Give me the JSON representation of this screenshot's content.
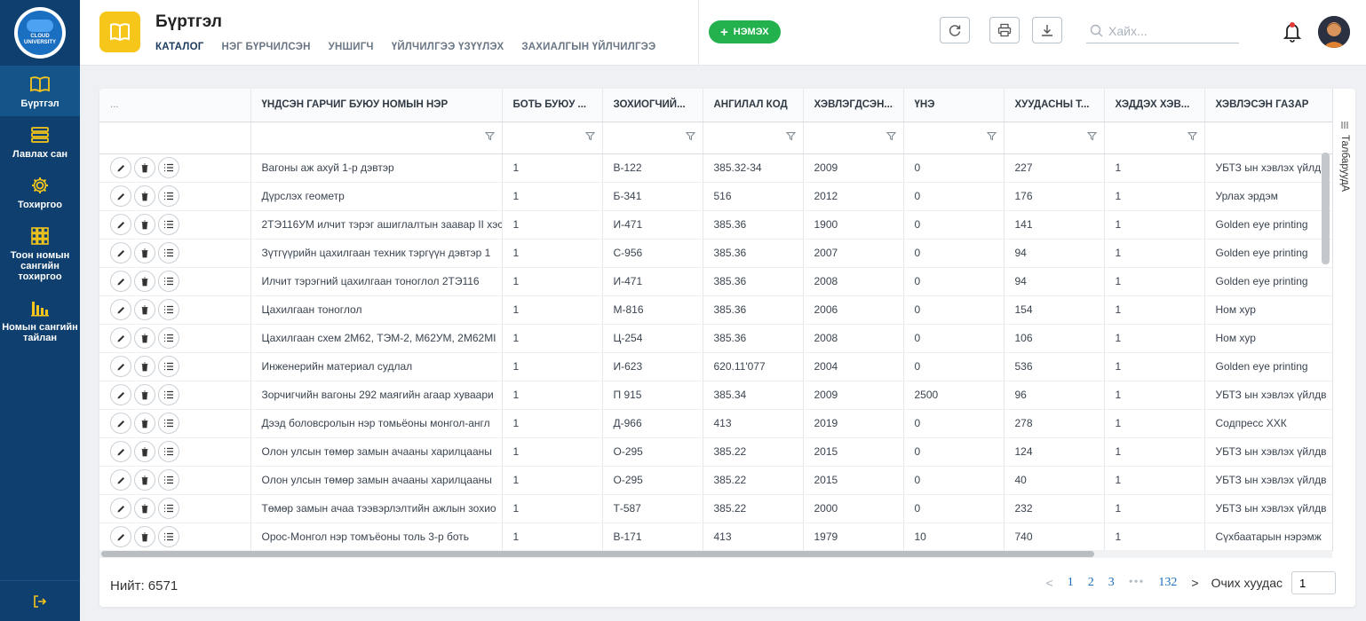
{
  "logo": {
    "line1": "CLOUD",
    "line2": "UNIVERSITY"
  },
  "sidebar": {
    "items": [
      {
        "label": "Бүртгэл",
        "icon": "book-icon"
      },
      {
        "label": "Лавлах сан",
        "icon": "layers-icon"
      },
      {
        "label": "Тохиргоо",
        "icon": "gear-icon"
      },
      {
        "label": "Тоон номын сангийн тохиргоо",
        "icon": "grid-icon"
      },
      {
        "label": "Номын сангийн тайлан",
        "icon": "report-icon"
      }
    ],
    "logout_icon": "logout-icon"
  },
  "header": {
    "title": "Бүртгэл",
    "tabs": [
      "КАТАЛОГ",
      "НЭГ БҮРЧИЛСЭН",
      "УНШИГЧ",
      "ҮЙЛЧИЛГЭЭ ҮЗҮҮЛЭХ",
      "ЗАХИАЛГЫН ҮЙЛЧИЛГЭЭ"
    ],
    "add_label": "НЭМЭХ",
    "search_placeholder": "Хайх..."
  },
  "table": {
    "columns": [
      "...",
      "ҮНДСЭН ГАРЧИГ БУЮУ НОМЫН НЭР",
      "БОТЬ БУЮУ ...",
      "ЗОХИОГЧИЙ...",
      "АНГИЛАЛ КОД",
      "ХЭВЛЭГДСЭН...",
      "ҮНЭ",
      "ХУУДАСНЫ Т...",
      "ХЭДДЭХ ХЭВ...",
      "ХЭВЛЭСЭН ГАЗАР"
    ],
    "rows": [
      [
        "Вагоны аж ахуй 1-р дэвтэр",
        "1",
        "В-122",
        "385.32-34",
        "2009",
        "0",
        "227",
        "1",
        "УБТЗ ын хэвлэх үйлдв"
      ],
      [
        "Дүрслэх геометр",
        "1",
        "Б-341",
        "516",
        "2012",
        "0",
        "176",
        "1",
        "Урлах эрдэм"
      ],
      [
        "2ТЭ116УМ илчит тэрэг ашиглалтын заавар II хэс",
        "1",
        "И-471",
        "385.36",
        "1900",
        "0",
        "141",
        "1",
        "Golden eye printing"
      ],
      [
        "Зүтгүүрийн цахилгаан техник тэргүүн дэвтэр 1",
        "1",
        "С-956",
        "385.36",
        "2007",
        "0",
        "94",
        "1",
        "Golden eye printing"
      ],
      [
        "Илчит тэрэгний цахилгаан тоноглол 2ТЭ116",
        "1",
        "И-471",
        "385.36",
        "2008",
        "0",
        "94",
        "1",
        "Golden eye printing"
      ],
      [
        "Цахилгаан тоноглол",
        "1",
        "М-816",
        "385.36",
        "2006",
        "0",
        "154",
        "1",
        "Ном хур"
      ],
      [
        "Цахилгаан схем 2М62, ТЭМ-2, М62УМ, 2М62МI",
        "1",
        "Ц-254",
        "385.36",
        "2008",
        "0",
        "106",
        "1",
        "Ном хур"
      ],
      [
        "Инженерийн материал судлал",
        "1",
        "И-623",
        "620.11'077",
        "2004",
        "0",
        "536",
        "1",
        "Golden eye printing"
      ],
      [
        "Зорчигчийн вагоны 292 маягийн агаар хуваари",
        "1",
        "П 915",
        "385.34",
        "2009",
        "2500",
        "96",
        "1",
        "УБТЗ ын хэвлэх үйлдв"
      ],
      [
        "Дээд боловсролын нэр томьёоны монгол-англ",
        "1",
        "Д-966",
        "413",
        "2019",
        "0",
        "278",
        "1",
        "Содпресс ХХК"
      ],
      [
        "Олон улсын төмөр замын ачааны харилцааны",
        "1",
        "О-295",
        "385.22",
        "2015",
        "0",
        "124",
        "1",
        "УБТЗ ын хэвлэх үйлдв"
      ],
      [
        "Олон улсын төмөр замын ачааны харилцааны",
        "1",
        "О-295",
        "385.22",
        "2015",
        "0",
        "40",
        "1",
        "УБТЗ ын хэвлэх үйлдв"
      ],
      [
        "Төмөр замын ачаа тээвэрлэлтийн ажлын зохио",
        "1",
        "Т-587",
        "385.22",
        "2000",
        "0",
        "232",
        "1",
        "УБТЗ ын хэвлэх үйлдв"
      ],
      [
        "Орос-Монгол нэр томъёоны толь 3-р боть",
        "1",
        "В-171",
        "413",
        "1979",
        "10",
        "740",
        "1",
        "Сүхбаатарын нэрэмж"
      ]
    ]
  },
  "side_panel_label": "ТалбаруудА",
  "footer": {
    "total": "Нийт: 6571",
    "pages": [
      "1",
      "2",
      "3",
      "132"
    ],
    "dots": "•••",
    "prev": "<",
    "next": ">",
    "page_size_label": "Очих хуудас",
    "page_input": "1"
  },
  "colors": {
    "sidebar": "#0f3f6e",
    "accent": "#f6c61a",
    "add_button": "#22b14c",
    "link": "#1b6fc0"
  }
}
